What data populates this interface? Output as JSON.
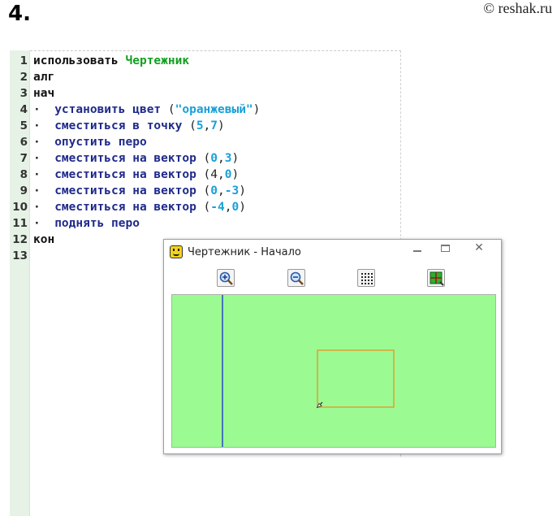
{
  "header": {
    "task_number": "4.",
    "watermark": "© reshak.ru"
  },
  "editor": {
    "lines": [
      {
        "n": "1",
        "tokens": [
          {
            "t": "использовать ",
            "c": "black"
          },
          {
            "t": "Чертежник",
            "c": "green"
          }
        ]
      },
      {
        "n": "2",
        "tokens": [
          {
            "t": "алг",
            "c": "black"
          }
        ]
      },
      {
        "n": "3",
        "tokens": [
          {
            "t": "нач",
            "c": "black"
          }
        ]
      },
      {
        "n": "4",
        "tokens": [
          {
            "t": "·  ",
            "c": "dot"
          },
          {
            "t": "установить цвет ",
            "c": "blue"
          },
          {
            "t": "(",
            "c": "punc"
          },
          {
            "t": "\"оранжевый\"",
            "c": "str"
          },
          {
            "t": ")",
            "c": "punc"
          }
        ]
      },
      {
        "n": "5",
        "tokens": [
          {
            "t": "·  ",
            "c": "dot"
          },
          {
            "t": "сместиться в точку ",
            "c": "blue"
          },
          {
            "t": "(",
            "c": "punc"
          },
          {
            "t": "5",
            "c": "num"
          },
          {
            "t": ",",
            "c": "punc"
          },
          {
            "t": "7",
            "c": "num"
          },
          {
            "t": ")",
            "c": "punc"
          }
        ]
      },
      {
        "n": "6",
        "tokens": [
          {
            "t": "·  ",
            "c": "dot"
          },
          {
            "t": "опустить перо",
            "c": "blue"
          }
        ]
      },
      {
        "n": "7",
        "tokens": [
          {
            "t": "·  ",
            "c": "dot"
          },
          {
            "t": "сместиться на вектор ",
            "c": "blue"
          },
          {
            "t": "(",
            "c": "punc"
          },
          {
            "t": "0",
            "c": "num"
          },
          {
            "t": ",",
            "c": "punc"
          },
          {
            "t": "3",
            "c": "num"
          },
          {
            "t": ")",
            "c": "punc"
          }
        ]
      },
      {
        "n": "8",
        "tokens": [
          {
            "t": "·  ",
            "c": "dot"
          },
          {
            "t": "сместиться на вектор ",
            "c": "blue"
          },
          {
            "t": "(4,",
            "c": "punc"
          },
          {
            "t": "0",
            "c": "num"
          },
          {
            "t": ")",
            "c": "punc"
          }
        ]
      },
      {
        "n": "9",
        "tokens": [
          {
            "t": "·  ",
            "c": "dot"
          },
          {
            "t": "сместиться на вектор ",
            "c": "blue"
          },
          {
            "t": "(",
            "c": "punc"
          },
          {
            "t": "0",
            "c": "num"
          },
          {
            "t": ",",
            "c": "punc"
          },
          {
            "t": "-3",
            "c": "num"
          },
          {
            "t": ")",
            "c": "punc"
          }
        ]
      },
      {
        "n": "10",
        "tokens": [
          {
            "t": "·  ",
            "c": "dot"
          },
          {
            "t": "сместиться на вектор ",
            "c": "blue"
          },
          {
            "t": "(",
            "c": "punc"
          },
          {
            "t": "-4",
            "c": "num"
          },
          {
            "t": ",",
            "c": "punc"
          },
          {
            "t": "0",
            "c": "num"
          },
          {
            "t": ")",
            "c": "punc"
          }
        ]
      },
      {
        "n": "11",
        "tokens": [
          {
            "t": "·  ",
            "c": "dot"
          },
          {
            "t": "поднять перо",
            "c": "blue"
          }
        ]
      },
      {
        "n": "12",
        "tokens": [
          {
            "t": "кон",
            "c": "black"
          }
        ]
      },
      {
        "n": "13",
        "tokens": []
      }
    ]
  },
  "window": {
    "title": "Чертежник - Начало",
    "controls": [
      "minimize",
      "maximize",
      "close"
    ],
    "toolbar": [
      "zoom-in-icon",
      "zoom-out-icon",
      "grid-icon",
      "fit-icon"
    ],
    "canvas": {
      "background": "#9bfa92",
      "axis_color": "#1a2bd0",
      "pen_color": "#f08a1a"
    }
  }
}
